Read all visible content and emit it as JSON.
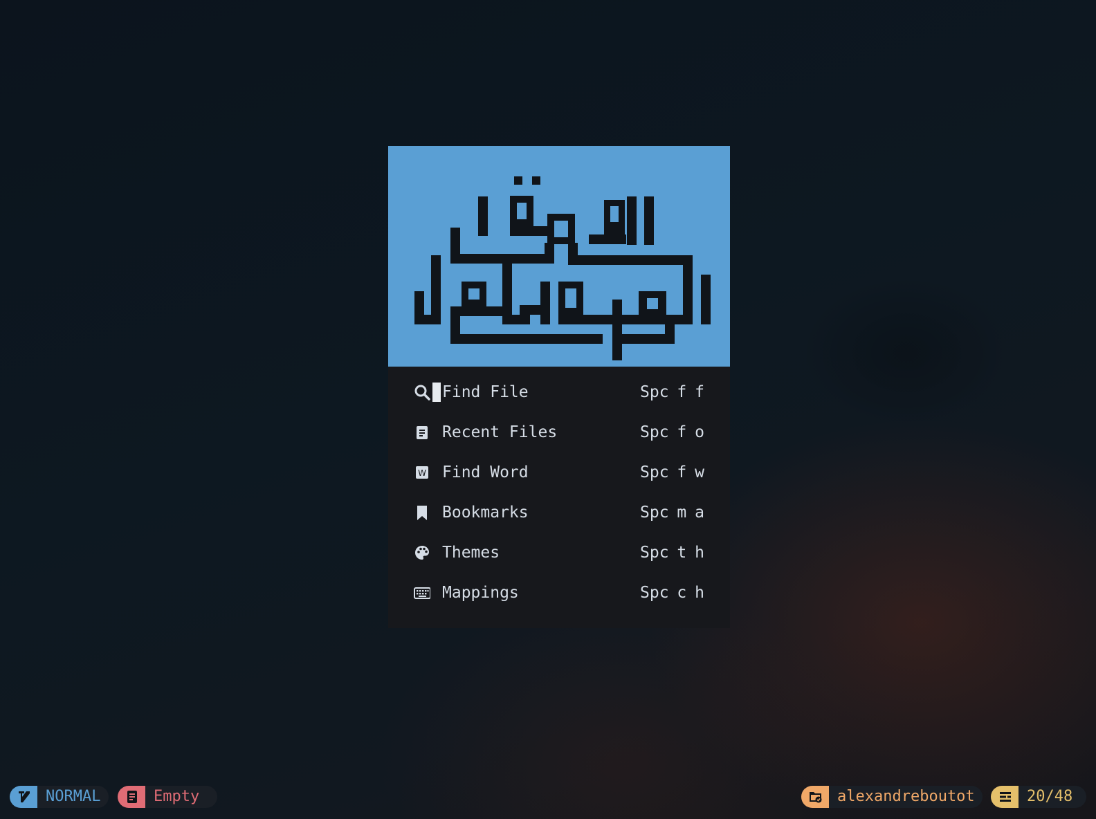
{
  "header": {
    "logo": "arabic-kufic-calligraphy-logo",
    "background_color": "#5a9fd4",
    "glyph_color": "#101419"
  },
  "menu": {
    "items": [
      {
        "icon": "search-icon",
        "label": "Find File",
        "shortcut": "Spc f f",
        "selected": true
      },
      {
        "icon": "file-text-icon",
        "label": "Recent Files",
        "shortcut": "Spc f o"
      },
      {
        "icon": "word-icon",
        "label": "Find Word",
        "shortcut": "Spc f w"
      },
      {
        "icon": "bookmark-icon",
        "label": "Bookmarks",
        "shortcut": "Spc m a"
      },
      {
        "icon": "palette-icon",
        "label": "Themes",
        "shortcut": "Spc t h"
      },
      {
        "icon": "keyboard-icon",
        "label": "Mappings",
        "shortcut": "Spc c h"
      }
    ]
  },
  "statusline": {
    "mode": {
      "label": "NORMAL",
      "icon": "vim-icon",
      "color": "#5a9fd4"
    },
    "file": {
      "label": "Empty",
      "icon": "file-icon",
      "color": "#e06c75"
    },
    "cwd": {
      "label": "alexandreboutot",
      "icon": "folder-icon",
      "color": "#f0a868"
    },
    "position": {
      "label": "20/48",
      "icon": "position-icon",
      "color": "#e5c06b"
    }
  },
  "colors": {
    "panel_bg": "#17181c",
    "text": "#d6dde6"
  }
}
